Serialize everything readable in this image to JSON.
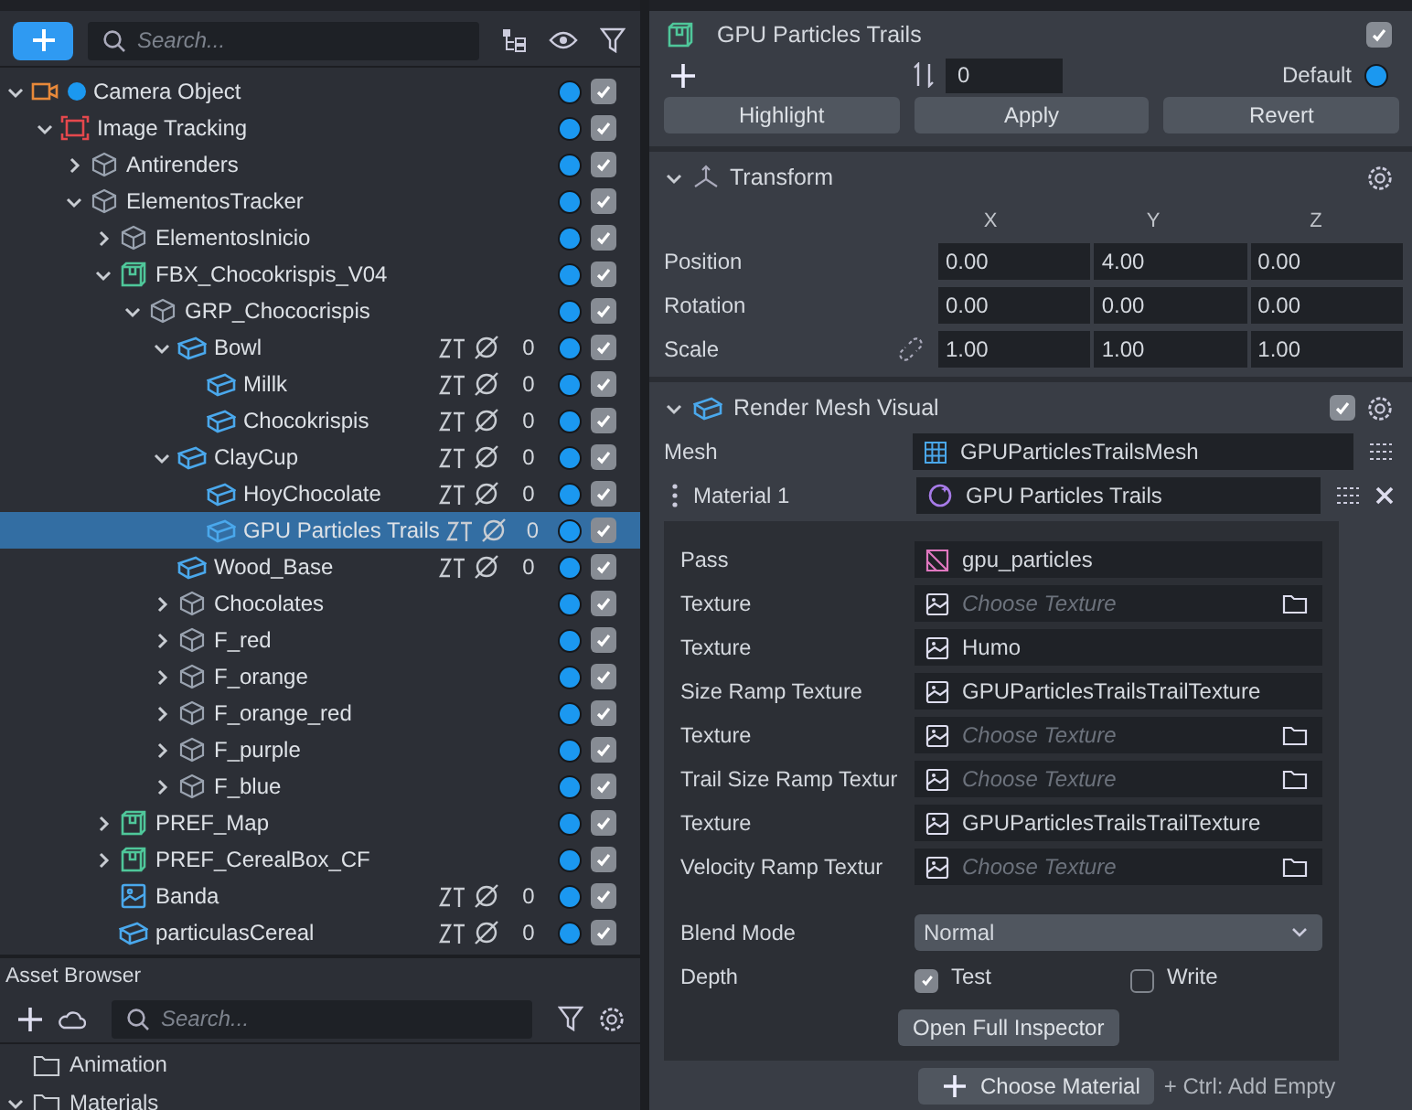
{
  "hierarchy": {
    "search_placeholder": "Search...",
    "nodes": [
      {
        "name": "Camera Object",
        "kind": "camera",
        "expanded": true,
        "checked": true,
        "selected": false,
        "children": [
          {
            "name": "Image Tracking",
            "kind": "tracking",
            "expanded": true,
            "checked": true,
            "selected": false,
            "children": [
              {
                "name": "Antirenders",
                "kind": "group",
                "expanded": false,
                "checked": true,
                "selected": false
              },
              {
                "name": "ElementosTracker",
                "kind": "group",
                "expanded": true,
                "checked": true,
                "selected": false,
                "children": [
                  {
                    "name": "ElementosInicio",
                    "kind": "group",
                    "expanded": false,
                    "checked": true,
                    "selected": false
                  },
                  {
                    "name": "FBX_Chocokrispis_V04",
                    "kind": "prefab",
                    "expanded": true,
                    "checked": true,
                    "selected": false,
                    "children": [
                      {
                        "name": "GRP_Chococrispis",
                        "kind": "group",
                        "expanded": true,
                        "checked": true,
                        "selected": false,
                        "children": [
                          {
                            "name": "Bowl",
                            "kind": "mesh",
                            "expanded": true,
                            "count": "0",
                            "checked": true,
                            "selected": false,
                            "children": [
                              {
                                "name": "Millk",
                                "kind": "mesh",
                                "count": "0",
                                "checked": true,
                                "selected": false
                              },
                              {
                                "name": "Chocokrispis",
                                "kind": "mesh",
                                "count": "0",
                                "checked": true,
                                "selected": false
                              }
                            ]
                          },
                          {
                            "name": "ClayCup",
                            "kind": "mesh",
                            "expanded": true,
                            "count": "0",
                            "checked": true,
                            "selected": false,
                            "children": [
                              {
                                "name": "HoyChocolate",
                                "kind": "mesh",
                                "count": "0",
                                "checked": true,
                                "selected": false
                              },
                              {
                                "name": "GPU Particles Trails",
                                "kind": "mesh",
                                "count": "0",
                                "checked": true,
                                "selected": true
                              }
                            ]
                          },
                          {
                            "name": "Wood_Base",
                            "kind": "mesh",
                            "count": "0",
                            "checked": true,
                            "selected": false
                          },
                          {
                            "name": "Chocolates",
                            "kind": "group",
                            "expanded": false,
                            "checked": true,
                            "selected": false
                          },
                          {
                            "name": "F_red",
                            "kind": "group",
                            "expanded": false,
                            "checked": true,
                            "selected": false
                          },
                          {
                            "name": "F_orange",
                            "kind": "group",
                            "expanded": false,
                            "checked": true,
                            "selected": false
                          },
                          {
                            "name": "F_orange_red",
                            "kind": "group",
                            "expanded": false,
                            "checked": true,
                            "selected": false
                          },
                          {
                            "name": "F_purple",
                            "kind": "group",
                            "expanded": false,
                            "checked": true,
                            "selected": false
                          },
                          {
                            "name": "F_blue",
                            "kind": "group",
                            "expanded": false,
                            "checked": true,
                            "selected": false
                          }
                        ]
                      }
                    ]
                  },
                  {
                    "name": "PREF_Map",
                    "kind": "prefab",
                    "expanded": false,
                    "checked": true,
                    "selected": false
                  },
                  {
                    "name": "PREF_CerealBox_CF",
                    "kind": "prefab",
                    "expanded": false,
                    "checked": true,
                    "selected": false
                  },
                  {
                    "name": "Banda",
                    "kind": "image",
                    "count": "0",
                    "checked": true,
                    "selected": false
                  },
                  {
                    "name": "particulasCereal",
                    "kind": "mesh",
                    "count": "0",
                    "checked": true,
                    "selected": false
                  }
                ]
              }
            ]
          }
        ]
      }
    ]
  },
  "asset_browser": {
    "title": "Asset Browser",
    "search_placeholder": "Search...",
    "items": [
      {
        "name": "Animation"
      },
      {
        "name": "Materials",
        "expanded": true
      }
    ]
  },
  "inspector": {
    "object": {
      "name": "GPU Particles Trails",
      "enabled": true
    },
    "order": "0",
    "layer": "Default",
    "buttons": [
      "Highlight",
      "Apply",
      "Revert"
    ],
    "transform": {
      "title": "Transform",
      "expanded": true,
      "axes": [
        "X",
        "Y",
        "Z"
      ],
      "rows": [
        {
          "label": "Position",
          "values": [
            "0.00",
            "4.00",
            "0.00"
          ]
        },
        {
          "label": "Rotation",
          "values": [
            "0.00",
            "0.00",
            "0.00"
          ]
        },
        {
          "label": "Scale",
          "linked": false,
          "values": [
            "1.00",
            "1.00",
            "1.00"
          ]
        }
      ]
    },
    "render_mesh": {
      "title": "Render Mesh Visual",
      "expanded": true,
      "enabled": true,
      "mesh": {
        "label": "Mesh",
        "value": "GPUParticlesTrailsMesh"
      },
      "material": {
        "label": "Material 1",
        "value": "GPU Particles Trails"
      },
      "pass": {
        "label": "Pass",
        "value": "gpu_particles"
      },
      "textures": [
        {
          "label": "Texture",
          "placeholder": "Choose Texture"
        },
        {
          "label": "Texture",
          "value": "Humo"
        },
        {
          "label": "Size Ramp Texture",
          "value": "GPUParticlesTrailsTrailTexture"
        },
        {
          "label": "Texture",
          "placeholder": "Choose Texture"
        },
        {
          "label": "Trail Size Ramp Textur",
          "placeholder": "Choose Texture"
        },
        {
          "label": "Texture",
          "value": "GPUParticlesTrailsTrailTexture"
        },
        {
          "label": "Velocity Ramp Textur",
          "placeholder": "Choose Texture"
        }
      ],
      "blend_mode": {
        "label": "Blend Mode",
        "value": "Normal"
      },
      "depth": {
        "label": "Depth",
        "options": [
          {
            "label": "Test",
            "checked": true
          },
          {
            "label": "Write",
            "checked": false
          }
        ]
      },
      "open_button": "Open Full Inspector",
      "choose_material": "Choose Material",
      "hint": "+ Ctrl: Add Empty"
    }
  }
}
